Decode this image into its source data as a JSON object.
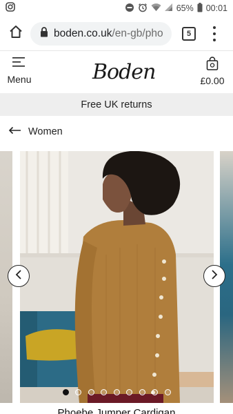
{
  "status_bar": {
    "battery": "65%",
    "time": "00:01",
    "icons": [
      "instagram-icon",
      "do-not-disturb-icon",
      "alarm-icon",
      "wifi-icon",
      "signal-icon",
      "battery-icon"
    ]
  },
  "browser": {
    "url_host": "boden.co.uk",
    "url_path": "/en-gb/pho",
    "tab_count": "5"
  },
  "header": {
    "menu_label": "Menu",
    "logo": "Boden",
    "basket_amount": "£0.00"
  },
  "promo": {
    "text": "Free UK returns"
  },
  "breadcrumb": {
    "label": "Women"
  },
  "gallery": {
    "total_images": 9,
    "active_index": 0
  },
  "product": {
    "name": "Phoebe Jumper Cardigan"
  },
  "colors": {
    "promo_bg": "#eeeeee",
    "cardigan": "#b0813f",
    "sofa": "#2d6b86"
  }
}
